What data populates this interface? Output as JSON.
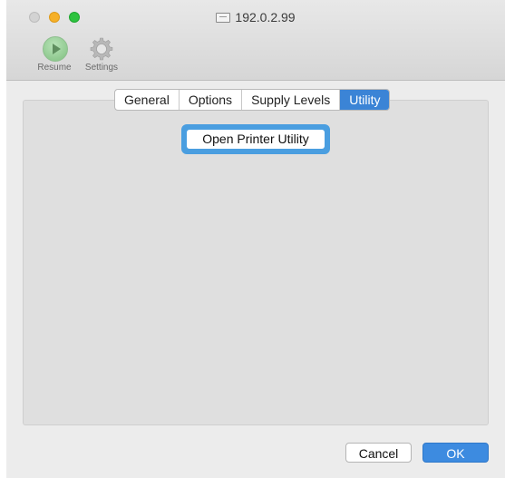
{
  "window": {
    "title": "192.0.2.99",
    "title_icon": "printer-queue-icon"
  },
  "toolbar": {
    "resume_label": "Resume",
    "settings_label": "Settings"
  },
  "tabs": [
    {
      "label": "General",
      "active": false
    },
    {
      "label": "Options",
      "active": false
    },
    {
      "label": "Supply Levels",
      "active": false
    },
    {
      "label": "Utility",
      "active": true
    }
  ],
  "utility": {
    "open_button_label": "Open Printer Utility"
  },
  "footer": {
    "cancel_label": "Cancel",
    "ok_label": "OK"
  },
  "colors": {
    "accent": "#3b84d6",
    "focus_ring": "#4a9ee0"
  }
}
